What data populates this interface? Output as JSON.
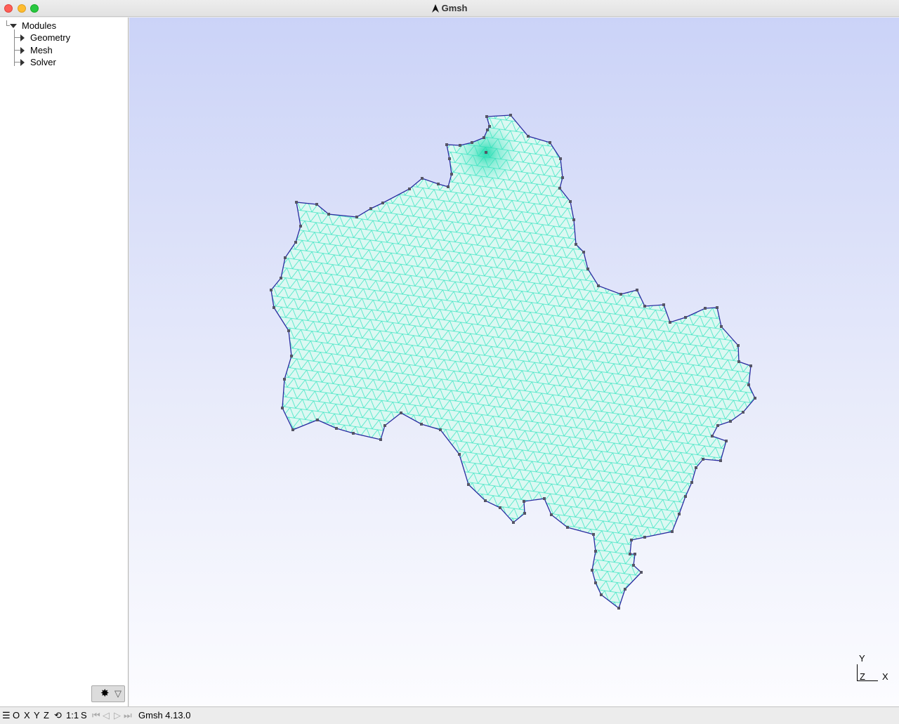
{
  "window": {
    "title": "Gmsh",
    "app_icon": "gmsh-arrow-icon",
    "controls": [
      "close",
      "minimize",
      "maximize"
    ]
  },
  "tree": {
    "root": {
      "label": "Modules",
      "expanded": true
    },
    "items": [
      {
        "label": "Geometry",
        "expanded": false
      },
      {
        "label": "Mesh",
        "expanded": false
      },
      {
        "label": "Solver",
        "expanded": false
      }
    ],
    "footer_icons": [
      "gear-icon",
      "filter-icon"
    ]
  },
  "viewport": {
    "background_top": "#cbd3f8",
    "background_bottom": "#fcfcff",
    "mesh_fill": "#dcf8f2",
    "mesh_edge_color": "#3fe6c4",
    "boundary_color": "#2a2aa0",
    "node_color": "#555566",
    "axes": {
      "y": "Y",
      "z": "Z",
      "x": "X"
    }
  },
  "statusbar": {
    "menu_icon": "☰",
    "orientation_buttons": [
      "O",
      "X",
      "Y",
      "Z"
    ],
    "rotate_icon": "rotate-icon",
    "scale_button": "1:1",
    "select_button": "S",
    "playback_icons": [
      "first-icon",
      "prev-icon",
      "play-icon",
      "next-icon"
    ],
    "message": "Gmsh 4.13.0"
  }
}
